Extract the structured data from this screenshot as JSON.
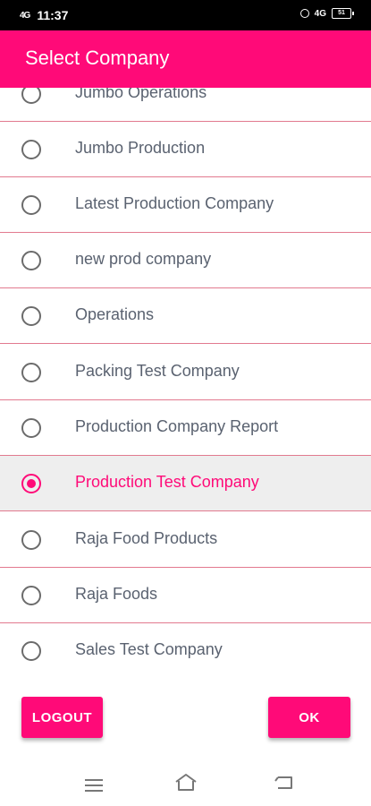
{
  "status_bar": {
    "signal": "4G",
    "time": "11:37",
    "network": "4G",
    "battery": "51"
  },
  "app_bar": {
    "title": "Select Company"
  },
  "companies": [
    {
      "label": "Jumbo Operations",
      "selected": false
    },
    {
      "label": "Jumbo Production",
      "selected": false
    },
    {
      "label": "Latest Production Company",
      "selected": false
    },
    {
      "label": "new prod company",
      "selected": false
    },
    {
      "label": "Operations",
      "selected": false
    },
    {
      "label": "Packing Test Company",
      "selected": false
    },
    {
      "label": "Production Company Report",
      "selected": false
    },
    {
      "label": "Production Test Company",
      "selected": true
    },
    {
      "label": "Raja Food Products",
      "selected": false
    },
    {
      "label": "Raja Foods",
      "selected": false
    },
    {
      "label": "Sales Test Company",
      "selected": false
    }
  ],
  "buttons": {
    "logout": "LOGOUT",
    "ok": "OK"
  },
  "colors": {
    "accent": "#ff0a78",
    "divider": "#e27a8f",
    "selected_row": "#eeeeee",
    "text": "#5a6270"
  }
}
